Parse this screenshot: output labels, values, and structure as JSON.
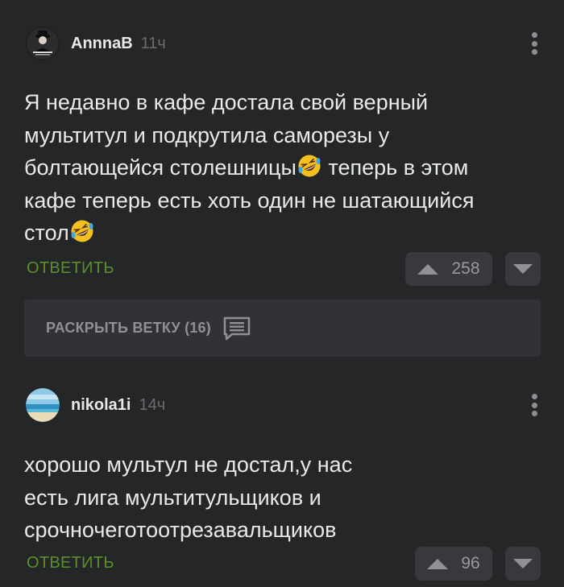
{
  "comments": [
    {
      "username": "AnnnaB",
      "time": "11ч",
      "text_parts": [
        "Я недавно в кафе достала свой верный мультитул и подкрутила саморезы у болтающейся столешницы",
        " теперь в этом кафе теперь есть хоть один не шатающийся стол"
      ],
      "emoji": "rolling-on-floor-laughing",
      "reply_label": "ОТВЕТИТЬ",
      "rating": "258",
      "avatar_icon": "avatar-dark-figure"
    },
    {
      "username": "nikola1i",
      "time": "14ч",
      "text": "хорошо мультул не достал,у нас есть лига мультитульщиков и срочночеготоотрезавальщиков",
      "reply_label": "ОТВЕТИТЬ",
      "rating": "96",
      "avatar_icon": "avatar-beach"
    }
  ],
  "thread": {
    "expand_label": "РАСКРЫТЬ ВЕТКУ (16)",
    "icon": "comment-lines-icon"
  },
  "colors": {
    "background": "#252628",
    "accent_reply": "#5a8f2c",
    "vote_bg": "#38393c",
    "expand_bg": "#313235"
  }
}
